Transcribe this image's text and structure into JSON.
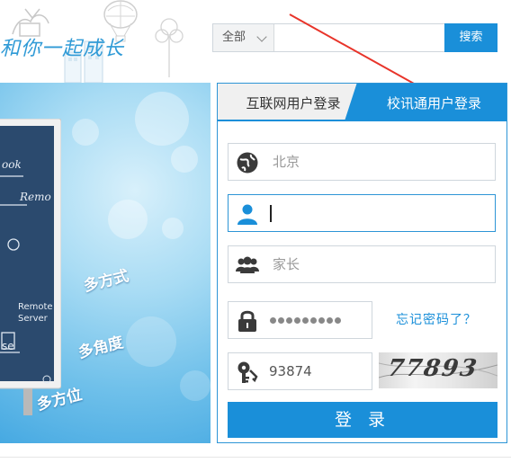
{
  "header": {
    "slogan": "和你一起成长"
  },
  "search": {
    "scope_label": "全部",
    "input_value": "",
    "button_label": "搜索"
  },
  "banner": {
    "words": [
      "多方式",
      "多角度",
      "多方位"
    ],
    "board_text": [
      "ook",
      "Remo",
      "Remote",
      "Server",
      "se"
    ]
  },
  "login": {
    "tabs": [
      {
        "label": "互联网用户登录",
        "active": false
      },
      {
        "label": "校讯通用户登录",
        "active": true
      }
    ],
    "region_placeholder": "北京",
    "username_value": "",
    "role_placeholder": "家长",
    "password_dots": 9,
    "code_value": "93874",
    "captcha_text": "77893",
    "forgot_label": "忘记密码了？",
    "submit_label": "登 录"
  },
  "colors": {
    "accent": "#1a8fd9",
    "slogan": "#2f9ad6",
    "annotation_arrow": "#e8342a"
  },
  "icons": [
    "globe-icon",
    "user-icon",
    "users-icon",
    "lock-icon",
    "keys-icon",
    "chevron-down-icon"
  ]
}
